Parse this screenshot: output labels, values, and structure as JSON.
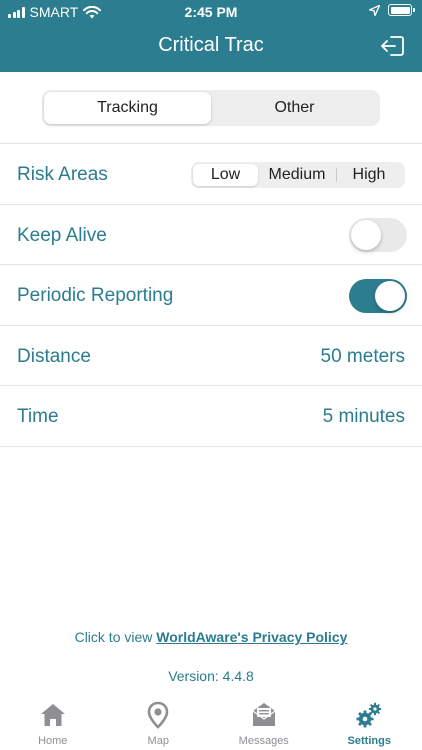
{
  "status": {
    "carrier": "SMART",
    "time": "2:45 PM"
  },
  "header": {
    "title": "Critical Trac",
    "logout_icon": "logout-icon"
  },
  "segments": {
    "selected": "Tracking",
    "items": [
      "Tracking",
      "Other"
    ]
  },
  "settings": {
    "risk_areas": {
      "label": "Risk Areas",
      "options": [
        "Low",
        "Medium",
        "High"
      ],
      "selected": "Low"
    },
    "keep_alive": {
      "label": "Keep Alive",
      "enabled": false
    },
    "periodic_reporting": {
      "label": "Periodic Reporting",
      "enabled": true
    },
    "distance": {
      "label": "Distance",
      "value": "50 meters"
    },
    "time": {
      "label": "Time",
      "value": "5 minutes"
    }
  },
  "footer": {
    "privacy_prefix": "Click to view ",
    "privacy_link": "WorldAware's Privacy Policy",
    "version": "Version: 4.4.8"
  },
  "tabs": [
    {
      "label": "Home",
      "icon": "home-icon"
    },
    {
      "label": "Map",
      "icon": "map-pin-icon"
    },
    {
      "label": "Messages",
      "icon": "envelope-icon"
    },
    {
      "label": "Settings",
      "icon": "gears-icon",
      "active": true
    }
  ],
  "colors": {
    "brand": "#2c7d8f",
    "text_accent": "#2a7c8e",
    "inactive_tab": "#8e8e93"
  }
}
